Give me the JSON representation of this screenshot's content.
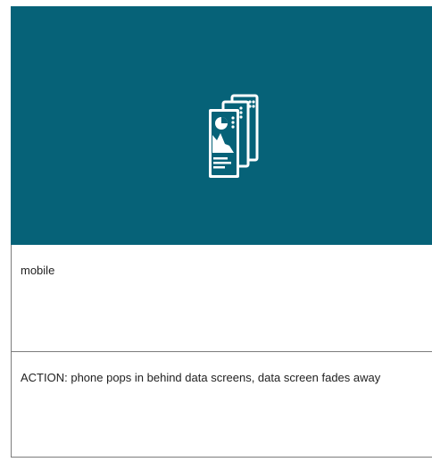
{
  "storyboard": {
    "hero": {
      "background_color": "#066278",
      "icon": "stacked-data-screens-icon"
    },
    "panels": [
      {
        "text": "mobile"
      },
      {
        "text": "ACTION: phone pops in behind data screens, data screen fades away"
      }
    ]
  }
}
